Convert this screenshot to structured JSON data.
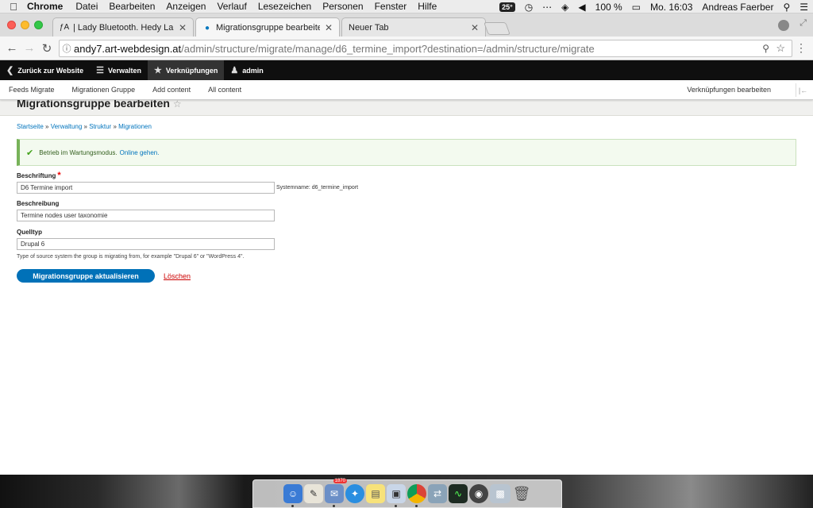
{
  "menubar": {
    "app": "Chrome",
    "items": [
      "Datei",
      "Bearbeiten",
      "Anzeigen",
      "Verlauf",
      "Lesezeichen",
      "Personen",
      "Fenster",
      "Hilfe"
    ],
    "temp": "25°",
    "battery": "100 %",
    "clock": "Mo. 16:03",
    "user": "Andreas Faerber"
  },
  "tabs": [
    {
      "title": "| Lady Bluetooth. Hedy Lamar",
      "favicon": "font-icon"
    },
    {
      "title": "Migrationsgruppe bearbeiten",
      "favicon": "drupal-icon"
    },
    {
      "title": "Neuer Tab",
      "favicon": ""
    }
  ],
  "address": {
    "host": "andy7.art-webdesign.at",
    "path": "/admin/structure/migrate/manage/d6_termine_import?destination=/admin/structure/migrate"
  },
  "toolbar": {
    "back": "Zurück zur Website",
    "manage": "Verwalten",
    "shortcuts": "Verknüpfungen",
    "user": "admin"
  },
  "tray": {
    "items": [
      "Feeds Migrate",
      "Migrationen Gruppe",
      "Add content",
      "All content"
    ],
    "edit": "Verknüpfungen bearbeiten"
  },
  "page": {
    "title": "Migrationsgruppe bearbeiten",
    "breadcrumb": [
      "Startseite",
      "Verwaltung",
      "Struktur",
      "Migrationen"
    ],
    "message": "Betrieb im Wartungsmodus.",
    "message_link": "Online gehen.",
    "fields": {
      "label_title": "Beschriftung",
      "label_value": "D6 Termine import",
      "machine_name": "Systemname: d6_termine_import",
      "description_title": "Beschreibung",
      "description_value": "Termine nodes user taxonomie",
      "source_title": "Quelltyp",
      "source_value": "Drupal 6",
      "source_help": "Type of source system the group is migrating from, for example \"Drupal 6\" or \"WordPress 4\"."
    },
    "submit": "Migrationsgruppe aktualisieren",
    "delete": "Löschen"
  },
  "dock": {
    "badge": "1870"
  }
}
